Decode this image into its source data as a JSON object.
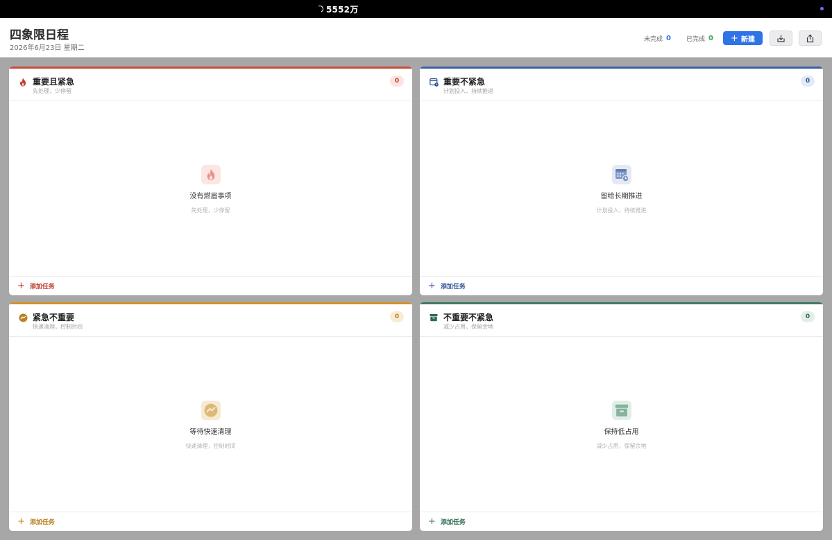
{
  "status": {
    "text": "5552万"
  },
  "header": {
    "title": "四象限日程",
    "date": "2026年6月23日 星期二",
    "pending_label": "未完成",
    "pending_count": "0",
    "done_label": "已完成",
    "done_count": "0",
    "new_label": "新建"
  },
  "quadrants": [
    {
      "title": "重要且紧急",
      "subtitle": "先处理，少停留",
      "count": "0",
      "empty_title": "没有燃眉事项",
      "empty_sub": "先处理，少停留",
      "add_label": "添加任务",
      "icon": "fire-icon",
      "color": "#c0392b"
    },
    {
      "title": "重要不紧急",
      "subtitle": "计划投入，持续推进",
      "count": "0",
      "empty_title": "留给长期推进",
      "empty_sub": "计划投入，持续推进",
      "add_label": "添加任务",
      "icon": "calendar-clock-icon",
      "color": "#2f5597"
    },
    {
      "title": "紧急不重要",
      "subtitle": "快速清理，控制时间",
      "count": "0",
      "empty_title": "等待快速清理",
      "empty_sub": "快速清理，控制时间",
      "add_label": "添加任务",
      "icon": "bolt-circle-icon",
      "color": "#b8801f"
    },
    {
      "title": "不重要不紧急",
      "subtitle": "减少占用，保留余地",
      "count": "0",
      "empty_title": "保持低占用",
      "empty_sub": "减少占用，保留余地",
      "add_label": "添加任务",
      "icon": "archive-box-icon",
      "color": "#2e6b50"
    }
  ]
}
